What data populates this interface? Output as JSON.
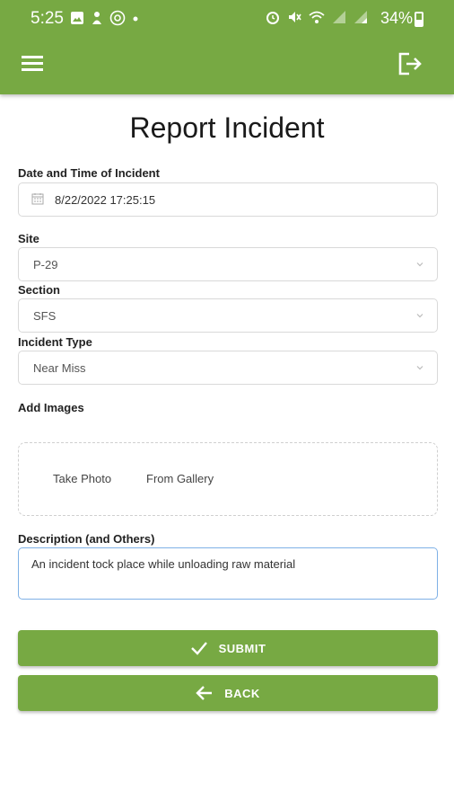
{
  "status_bar": {
    "time": "5:25",
    "battery_pct": "34%",
    "left_icons": [
      "gallery-icon",
      "notification-icon",
      "at-icon",
      "dot-icon"
    ],
    "right_icons": [
      "alarm-icon",
      "mute-icon",
      "wifi-icon",
      "signal-icon",
      "signal-icon"
    ]
  },
  "app_bar": {
    "color": "#77a943",
    "left_icon": "menu-icon",
    "right_icon": "logout-icon"
  },
  "page": {
    "title": "Report Incident"
  },
  "form": {
    "datetime": {
      "label": "Date and Time of Incident",
      "value": "8/22/2022 17:25:15"
    },
    "site": {
      "label": "Site",
      "value": "P-29"
    },
    "section": {
      "label": "Section",
      "value": "SFS"
    },
    "incident_type": {
      "label": "Incident Type",
      "value": "Near Miss"
    },
    "images": {
      "label": "Add Images",
      "take_photo": "Take Photo",
      "from_gallery": "From Gallery"
    },
    "description": {
      "label": "Description (and Others)",
      "value": "An incident tock place while unloading raw material"
    }
  },
  "actions": {
    "submit_label": "SUBMIT",
    "back_label": "BACK"
  }
}
